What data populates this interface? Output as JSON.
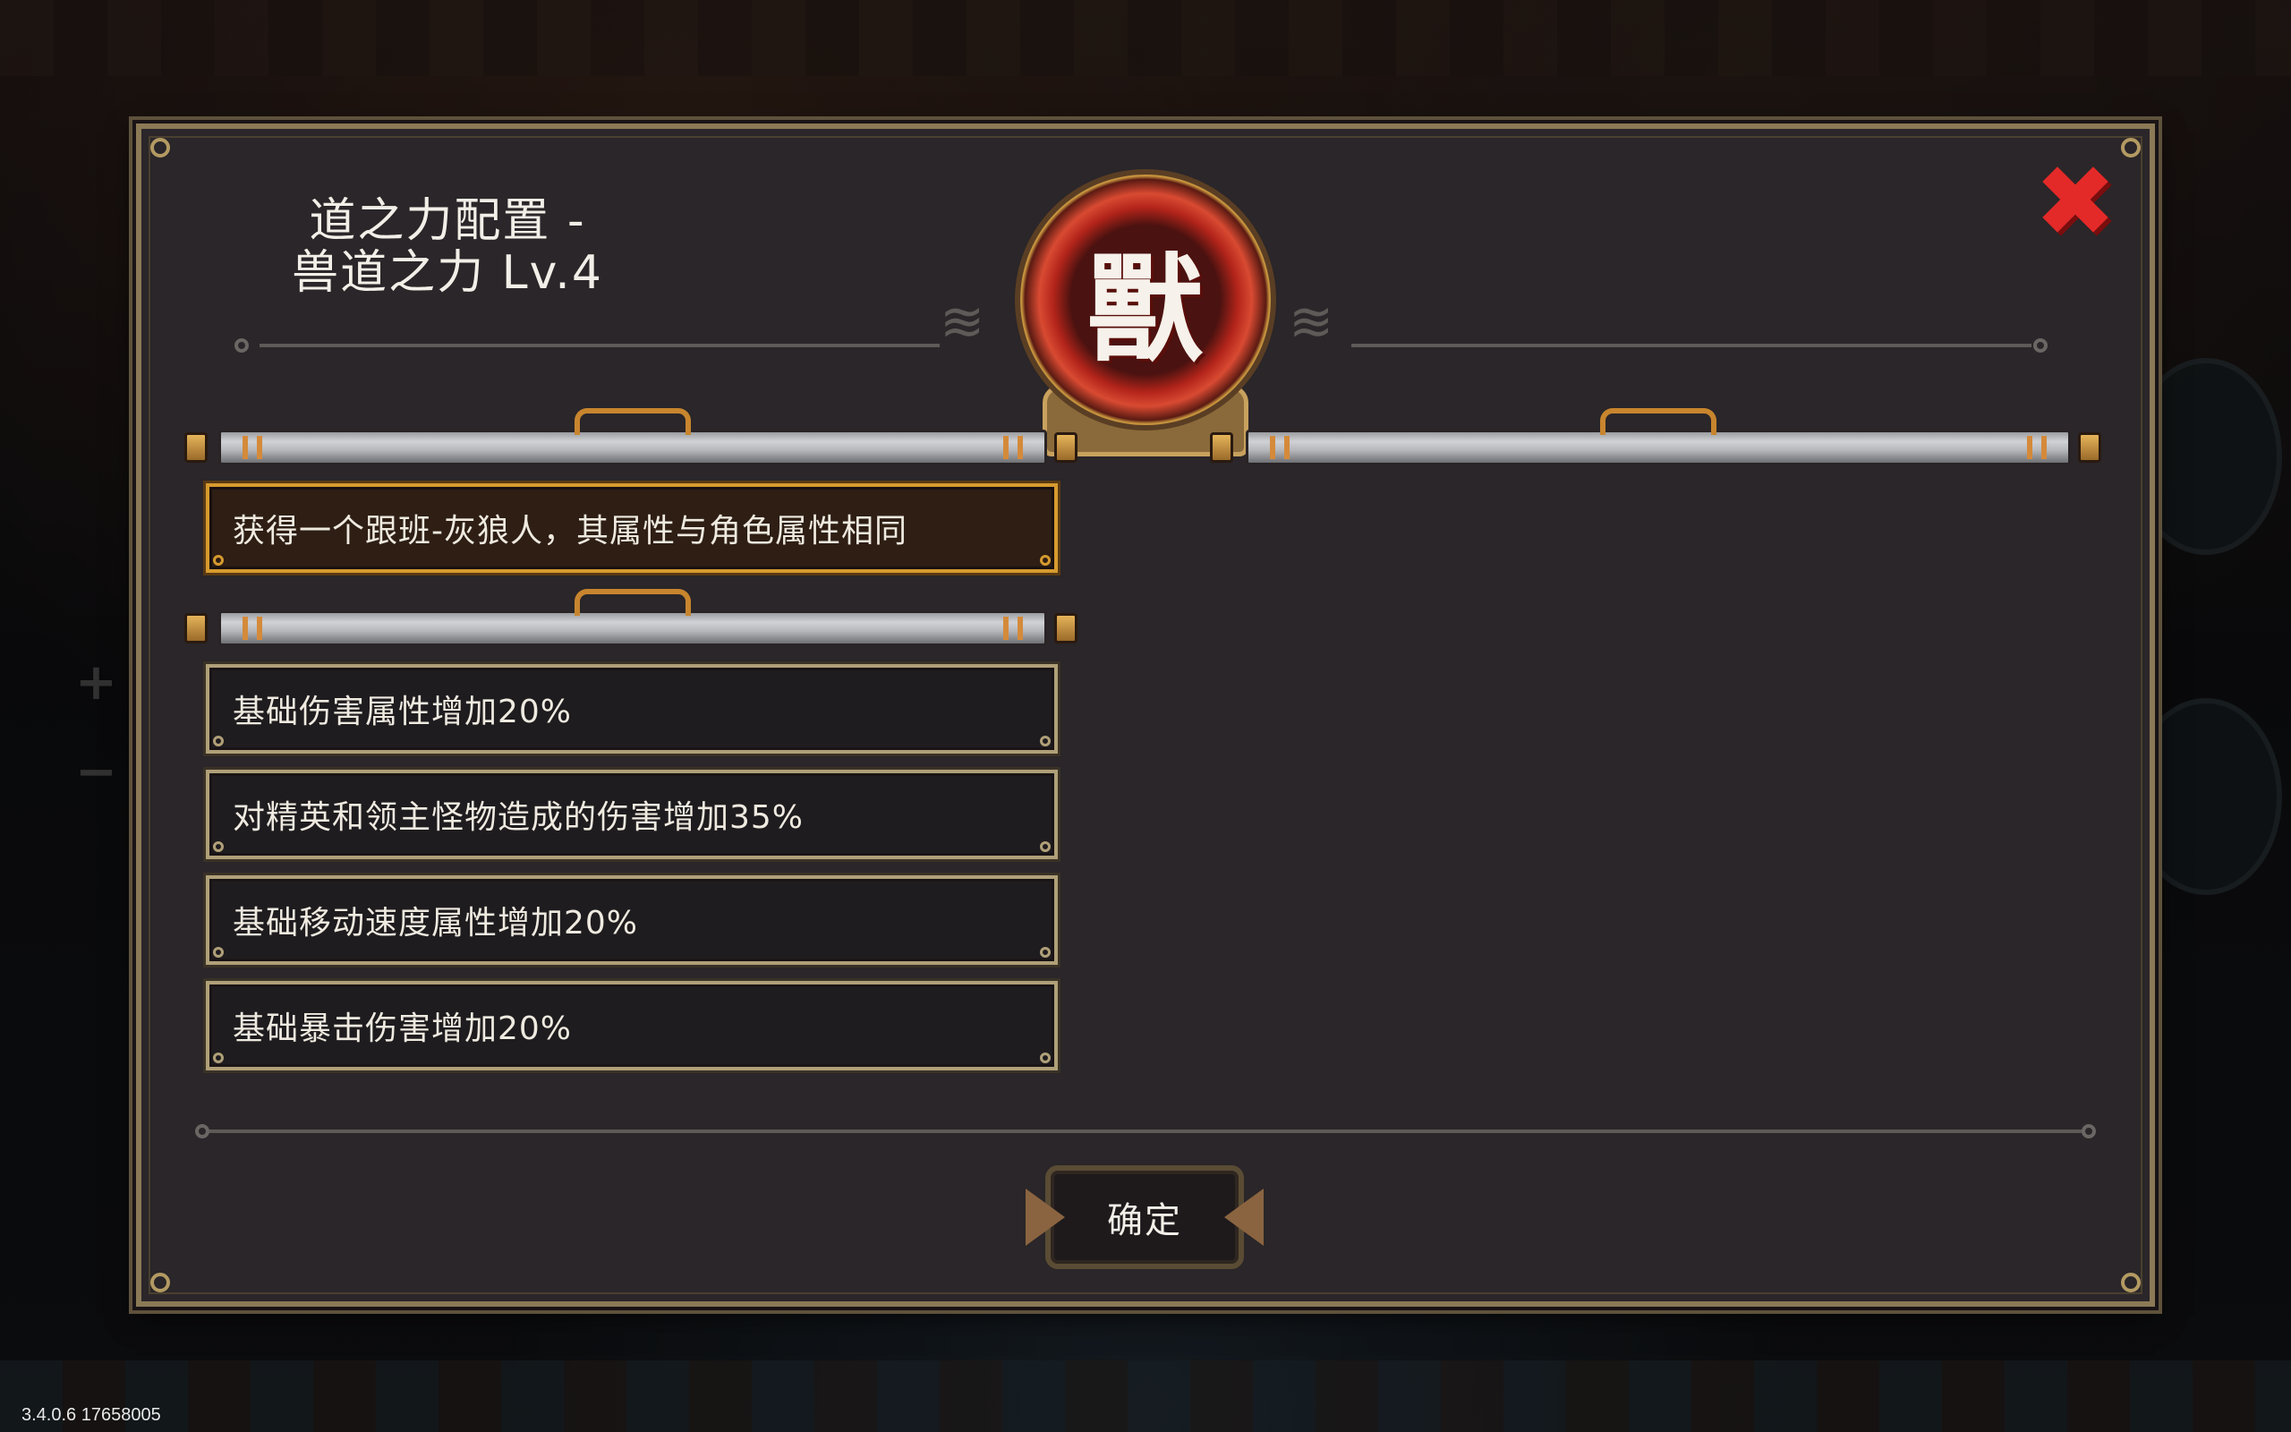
{
  "dialog": {
    "title_line1": "道之力配置 -",
    "title_line2": "兽道之力 Lv.4",
    "emblem_char": "獸",
    "close_glyph": "✖"
  },
  "primary_effect": {
    "text": "获得一个跟班-灰狼人，其属性与角色属性相同"
  },
  "effects": [
    {
      "text": "基础伤害属性增加20%"
    },
    {
      "text": "对精英和领主怪物造成的伤害增加35%"
    },
    {
      "text": "基础移动速度属性增加20%"
    },
    {
      "text": "基础暴击伤害增加20%"
    }
  ],
  "confirm_button": {
    "label": "确定"
  },
  "version": "3.4.0.6 17658005",
  "colors": {
    "panel_bg": "#2a2629",
    "panel_border": "#8c7a56",
    "highlight_border": "#d69a2e",
    "close_red": "#e32a28",
    "emblem_red": "#b2241a"
  },
  "icons": {
    "close": "close-icon",
    "emblem": "beast-emblem-icon",
    "confirm_arrows": "arrow-icon"
  }
}
